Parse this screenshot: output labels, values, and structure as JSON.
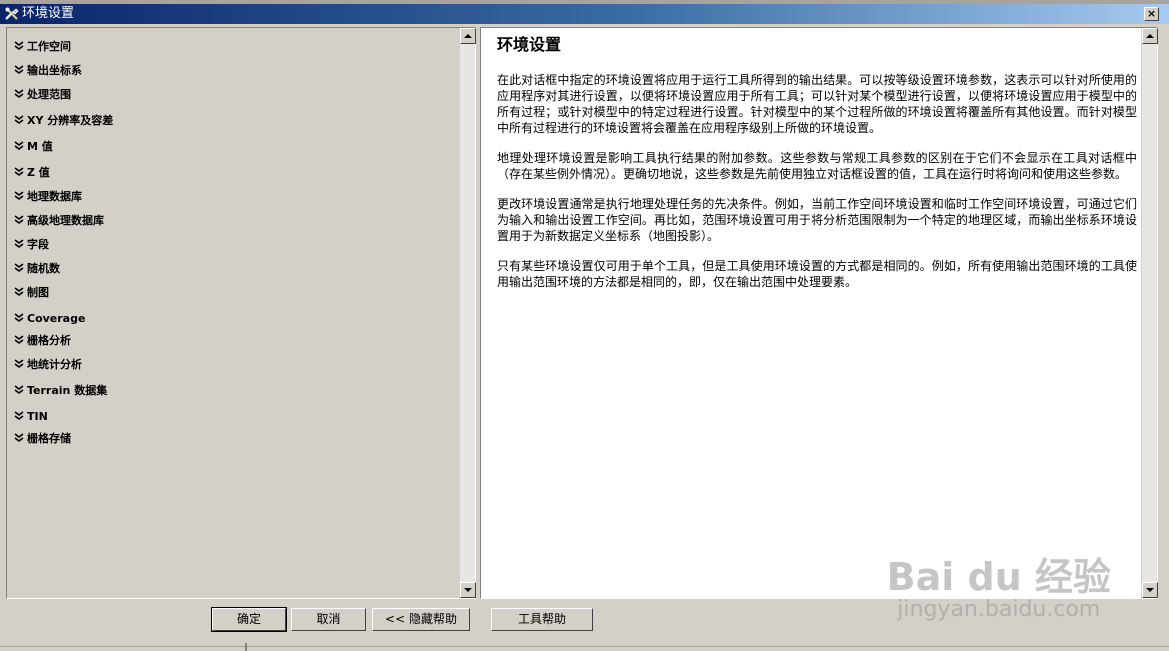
{
  "window": {
    "title": "环境设置",
    "close_glyph": "×"
  },
  "categories": [
    {
      "label": "工作空间",
      "icon": "chevron-down-icon"
    },
    {
      "label": "输出坐标系",
      "icon": "chevron-down-icon"
    },
    {
      "label": "处理范围",
      "icon": "chevron-down-icon"
    },
    {
      "label": "XY 分辨率及容差",
      "icon": "chevron-down-icon"
    },
    {
      "label": "M 值",
      "icon": "chevron-down-icon"
    },
    {
      "label": "Z 值",
      "icon": "chevron-down-icon"
    },
    {
      "label": "地理数据库",
      "icon": "chevron-down-icon"
    },
    {
      "label": "高级地理数据库",
      "icon": "chevron-down-icon"
    },
    {
      "label": "字段",
      "icon": "chevron-down-icon"
    },
    {
      "label": "随机数",
      "icon": "chevron-down-icon"
    },
    {
      "label": "制图",
      "icon": "chevron-down-icon"
    },
    {
      "label": "Coverage",
      "icon": "chevron-down-icon"
    },
    {
      "label": "栅格分析",
      "icon": "chevron-down-icon"
    },
    {
      "label": "地统计分析",
      "icon": "chevron-down-icon"
    },
    {
      "label": "Terrain 数据集",
      "icon": "chevron-down-icon"
    },
    {
      "label": "TIN",
      "icon": "chevron-down-icon"
    },
    {
      "label": "栅格存储",
      "icon": "chevron-down-icon"
    }
  ],
  "help": {
    "title": "环境设置",
    "paragraphs": [
      "在此对话框中指定的环境设置将应用于运行工具所得到的输出结果。可以按等级设置环境参数，这表示可以针对所使用的应用程序对其进行设置，以便将环境设置应用于所有工具；可以针对某个模型进行设置，以便将环境设置应用于模型中的所有过程；或针对模型中的特定过程进行设置。针对模型中的某个过程所做的环境设置将覆盖所有其他设置。而针对模型中所有过程进行的环境设置将会覆盖在应用程序级别上所做的环境设置。",
      "地理处理环境设置是影响工具执行结果的附加参数。这些参数与常规工具参数的区别在于它们不会显示在工具对话框中（存在某些例外情况）。更确切地说，这些参数是先前使用独立对话框设置的值，工具在运行时将询问和使用这些参数。",
      "更改环境设置通常是执行地理处理任务的先决条件。例如，当前工作空间环境设置和临时工作空间环境设置，可通过它们为输入和输出设置工作空间。再比如，范围环境设置可用于将分析范围限制为一个特定的地理区域，而输出坐标系环境设置用于为新数据定义坐标系（地图投影）。",
      "只有某些环境设置仅可用于单个工具，但是工具使用环境设置的方式都是相同的。例如，所有使用输出范围环境的工具使用输出范围环境的方法都是相同的，即，仅在输出范围中处理要素。"
    ]
  },
  "buttons": {
    "ok": "确定",
    "cancel": "取消",
    "hide_help": "<< 隐藏帮助",
    "tool_help": "工具帮助"
  },
  "watermark": {
    "logo": "Bai du 经验",
    "sub": "jingyan.baidu.com"
  }
}
